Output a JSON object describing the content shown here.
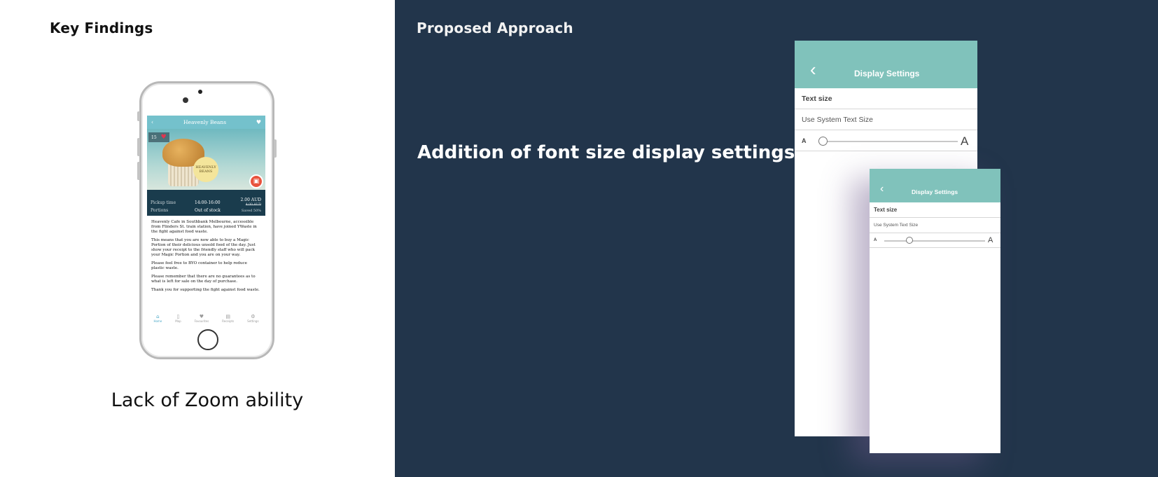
{
  "left": {
    "heading": "Key Findings",
    "caption": "Lack of Zoom ability",
    "phone_screen": {
      "nav_back_icon": "‹",
      "title": "Heavenly Beans",
      "nav_heart_icon": "♥",
      "favorites_count": "15",
      "image_tag_text": "HEAVENLY BEANS",
      "basket_icon": "🧺",
      "pickup_label": "Pickup time",
      "pickup_value": "14:00-16:00",
      "price": "2.00 AUD",
      "old_price": "4.00 AUD",
      "portions_label": "Portions",
      "portions_value": "Out of stock",
      "saved": "Saved 50%",
      "paragraphs": [
        "Heavenly Cafe in Southbank Melbourne, accessible from Flinders St. train station, have joined YWaste in the fight against food waste.",
        "This means that you are now able to buy a Magic Portion of their delicious unsold food of the day. Just show your receipt to the friendly staff who will pack your Magic Portion and you are on your way.",
        "Please feel free to BYO container to help reduce plastic waste.",
        "Please remember that there are no guarantees as to what is left for sale on the day of purchase.",
        "Thank you for supporting the fight against food waste."
      ],
      "tabs": [
        {
          "icon": "⌂",
          "label": "Home"
        },
        {
          "icon": "▯",
          "label": "Map"
        },
        {
          "icon": "♥",
          "label": "Favourites"
        },
        {
          "icon": "▤",
          "label": "Receipts"
        },
        {
          "icon": "⚙",
          "label": "Settings"
        }
      ]
    }
  },
  "right": {
    "heading": "Proposed Approach",
    "statement": "Addition of font size display settings.",
    "settings_large": {
      "back_icon": "‹",
      "title": "Display Settings",
      "section_label": "Text size",
      "option_label": "Use System Text Size",
      "small_a": "A",
      "large_a": "A",
      "slider_value": 0
    },
    "settings_small": {
      "back_icon": "‹",
      "title": "Display Settings",
      "section_label": "Text size",
      "option_label": "Use System Text Size",
      "small_a": "A",
      "large_a": "A",
      "slider_value": 0.25
    }
  },
  "colors": {
    "right_background": "#22354b",
    "settings_header": "#80c2bb",
    "app_nav": "#74c1cc",
    "app_info_bar": "#1a3c4d",
    "active_tab": "#4aa8c7"
  }
}
